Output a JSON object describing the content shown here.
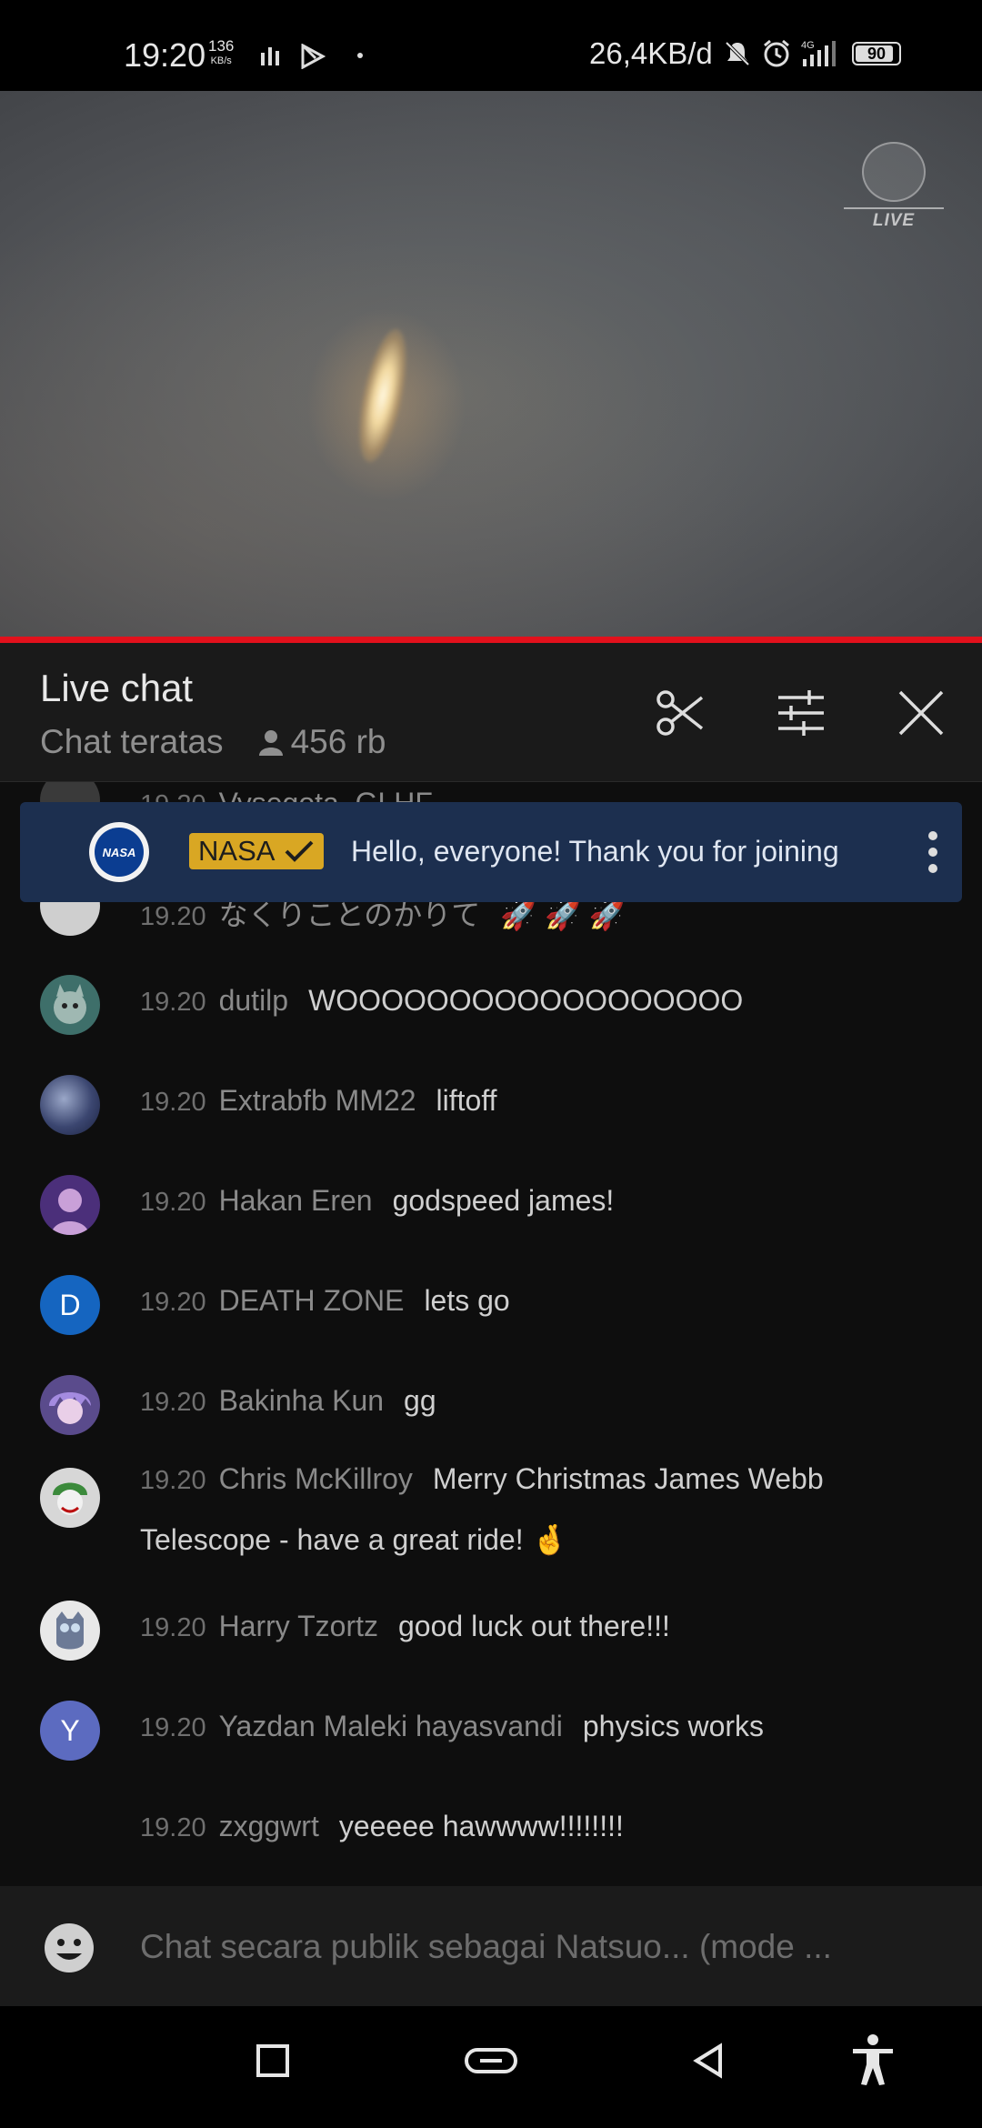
{
  "status_bar": {
    "time": "19:20",
    "speed_value": "136",
    "speed_unit": "KB/s",
    "data_usage": "26,4KB/d",
    "network": "4G",
    "battery": "90"
  },
  "video": {
    "live_label": "LIVE",
    "progress": 1.0
  },
  "chat_header": {
    "title": "Live chat",
    "mode": "Chat teratas",
    "viewers": "456 rb"
  },
  "pinned": {
    "author": "NASA",
    "message": "Hello, everyone! Thank you for joining"
  },
  "messages": [
    {
      "time": "19.20",
      "author": "Vysegota_GLHF",
      "text": ""
    },
    {
      "time": "19.20",
      "author": "なくりことのかりて",
      "text": "🚀 🚀 🚀"
    },
    {
      "time": "19.20",
      "author": "dutilp",
      "text": "WOOOOOOOOOOOOOOOOOO"
    },
    {
      "time": "19.20",
      "author": "Extrabfb MM22",
      "text": "liftoff"
    },
    {
      "time": "19.20",
      "author": "Hakan Eren",
      "text": "godspeed james!"
    },
    {
      "time": "19.20",
      "author": "DEATH ZONE",
      "text": "lets go",
      "initial": "D"
    },
    {
      "time": "19.20",
      "author": "Bakinha Kun",
      "text": "gg"
    },
    {
      "time": "19.20",
      "author": "Chris McKillroy",
      "text": "Merry Christmas James Webb",
      "text_cont": "Telescope - have a great ride! 🤞"
    },
    {
      "time": "19.20",
      "author": "Harry Tzortz",
      "text": "good luck out there!!!"
    },
    {
      "time": "19.20",
      "author": "Yazdan Maleki hayasvandi",
      "text": "physics works",
      "initial": "Y"
    },
    {
      "time": "19.20",
      "author": "zxggwrt",
      "text": "yeeeee hawwww!!!!!!!!"
    }
  ],
  "composer": {
    "placeholder": "Chat secara publik sebagai Natsuo... (mode ..."
  },
  "colors": {
    "progress_red": "#e2111c",
    "pinned_bg": "#1c2f4f",
    "owner_badge": "#d9a723"
  }
}
